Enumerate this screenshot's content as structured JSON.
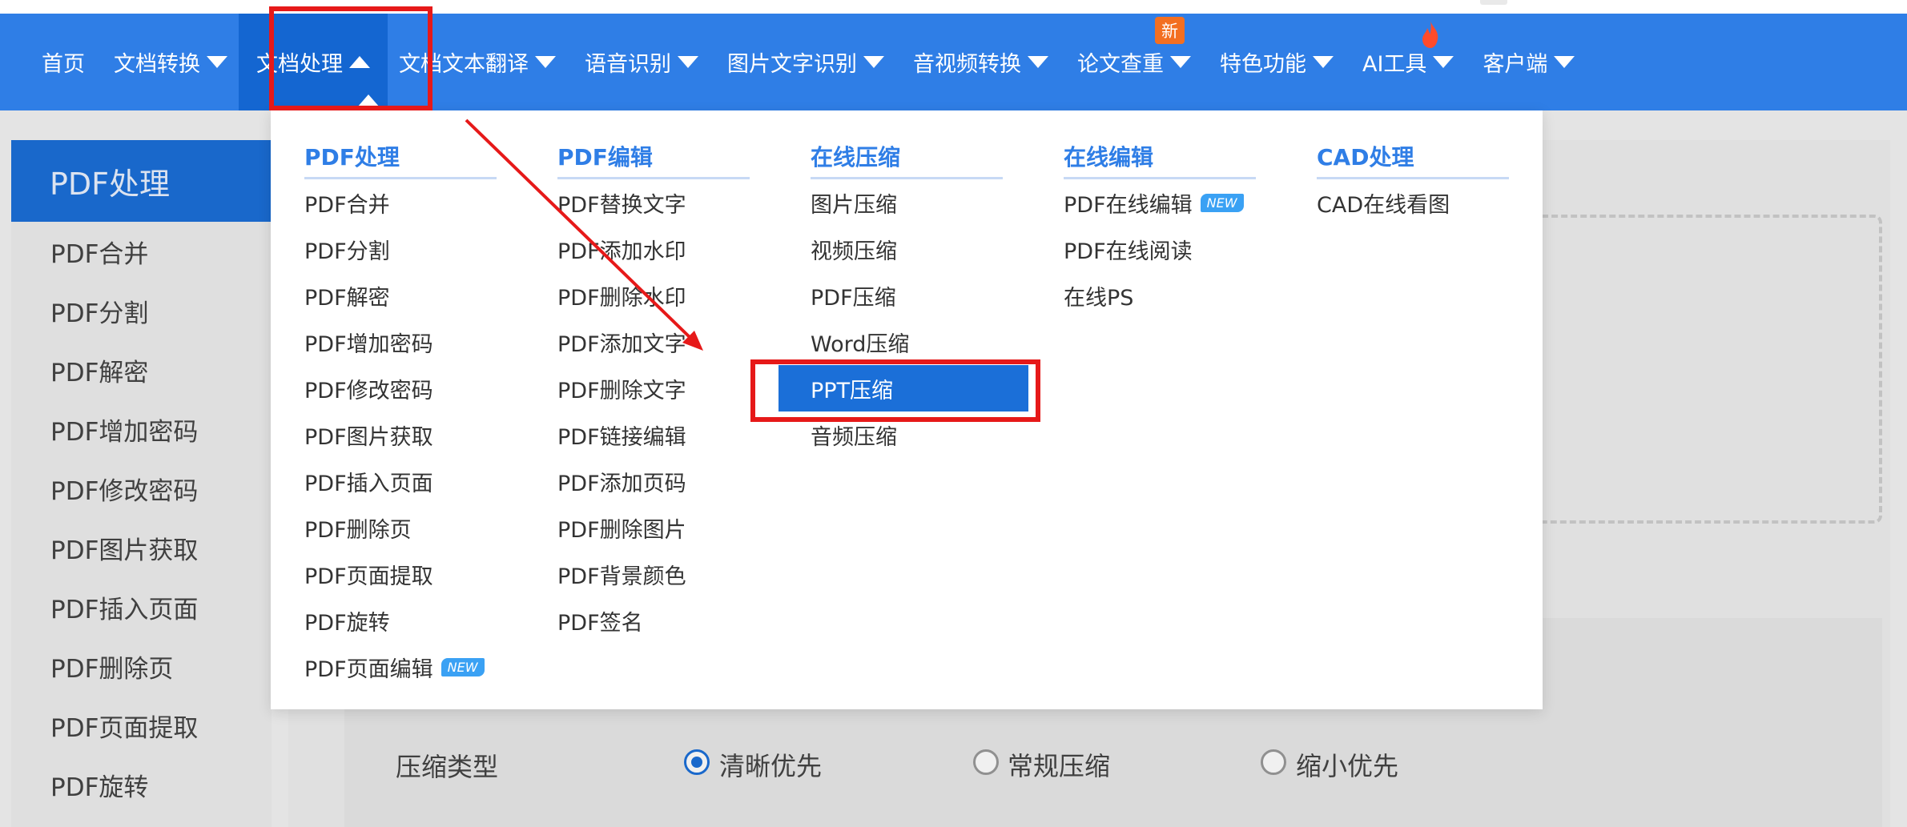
{
  "nav": {
    "items": [
      {
        "label": "首页"
      },
      {
        "label": "文档转换"
      },
      {
        "label": "文档处理"
      },
      {
        "label": "文档文本翻译"
      },
      {
        "label": "语音识别"
      },
      {
        "label": "图片文字识别"
      },
      {
        "label": "音视频转换"
      },
      {
        "label": "论文查重",
        "badge": "新"
      },
      {
        "label": "特色功能"
      },
      {
        "label": "AI工具"
      },
      {
        "label": "客户端"
      }
    ],
    "accent": "#2f7ee6"
  },
  "sidebar": {
    "title": "PDF处理",
    "items": [
      "PDF合并",
      "PDF分割",
      "PDF解密",
      "PDF增加密码",
      "PDF修改密码",
      "PDF图片获取",
      "PDF插入页面",
      "PDF删除页",
      "PDF页面提取",
      "PDF旋转"
    ]
  },
  "dropdown": {
    "columns": [
      {
        "title": "PDF处理",
        "items": [
          "PDF合并",
          "PDF分割",
          "PDF解密",
          "PDF增加密码",
          "PDF修改密码",
          "PDF图片获取",
          "PDF插入页面",
          "PDF删除页",
          "PDF页面提取",
          "PDF旋转",
          "PDF页面编辑"
        ]
      },
      {
        "title": "PDF编辑",
        "items": [
          "PDF替换文字",
          "PDF添加水印",
          "PDF删除水印",
          "PDF添加文字",
          "PDF删除文字",
          "PDF链接编辑",
          "PDF添加页码",
          "PDF删除图片",
          "PDF背景颜色",
          "PDF签名"
        ]
      },
      {
        "title": "在线压缩",
        "items": [
          "图片压缩",
          "视频压缩",
          "PDF压缩",
          "Word压缩",
          "PPT压缩",
          "音频压缩"
        ]
      },
      {
        "title": "在线编辑",
        "items": [
          "PDF在线编辑",
          "PDF在线阅读",
          "在线PS"
        ]
      },
      {
        "title": "CAD处理",
        "items": [
          "CAD在线看图"
        ]
      }
    ],
    "new_badge": "NEW",
    "selected_item": "PPT压缩"
  },
  "compress_options": {
    "label": "压缩类型",
    "options": [
      "清晰优先",
      "常规压缩",
      "缩小优先"
    ],
    "selected": "清晰优先"
  }
}
